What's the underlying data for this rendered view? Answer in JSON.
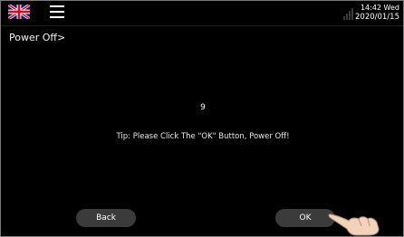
{
  "topbar": {
    "language_icon": "uk-flag-icon",
    "menu_icon": "hamburger-menu-icon",
    "signal_icon": "signal-strength-icon",
    "time": "14:42 Wed",
    "date": "2020/01/15"
  },
  "page": {
    "title": "Power Off>",
    "countdown": "9",
    "tip": "Tip: Please Click The \"OK\" Button, Power Off!"
  },
  "buttons": {
    "back_label": "Back",
    "ok_label": "OK"
  },
  "colors": {
    "background": "#000000",
    "button_bg": "#3b3b3b",
    "text": "#ffffff"
  }
}
